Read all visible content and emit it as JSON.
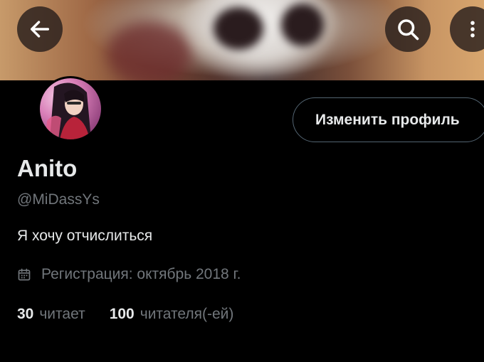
{
  "header": {
    "back_icon": "arrow-left-icon",
    "search_icon": "search-icon",
    "more_icon": "more-vertical-icon"
  },
  "profile": {
    "display_name": "Anito",
    "handle": "@MiDassYs",
    "bio": "Я хочу отчислиться",
    "joined_icon": "calendar-icon",
    "joined": "Регистрация: октябрь 2018 г.",
    "edit_button_label": "Изменить профиль",
    "following_count": "30",
    "following_label": "читает",
    "followers_count": "100",
    "followers_label": "читателя(-ей)"
  },
  "colors": {
    "background": "#000000",
    "primary_text": "#e7e9ea",
    "secondary_text": "#71767b",
    "button_border": "#536471"
  }
}
